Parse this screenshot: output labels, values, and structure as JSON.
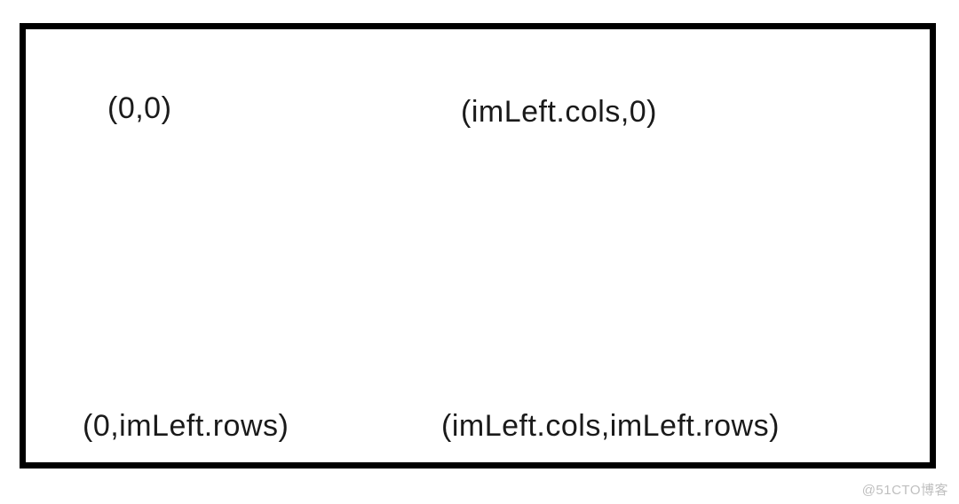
{
  "diagram": {
    "corners": {
      "top_left": "(0,0)",
      "top_right": "(imLeft.cols,0)",
      "bottom_left": "(0,imLeft.rows)",
      "bottom_right": "(imLeft.cols,imLeft.rows)"
    }
  },
  "watermark": "@51CTO博客"
}
